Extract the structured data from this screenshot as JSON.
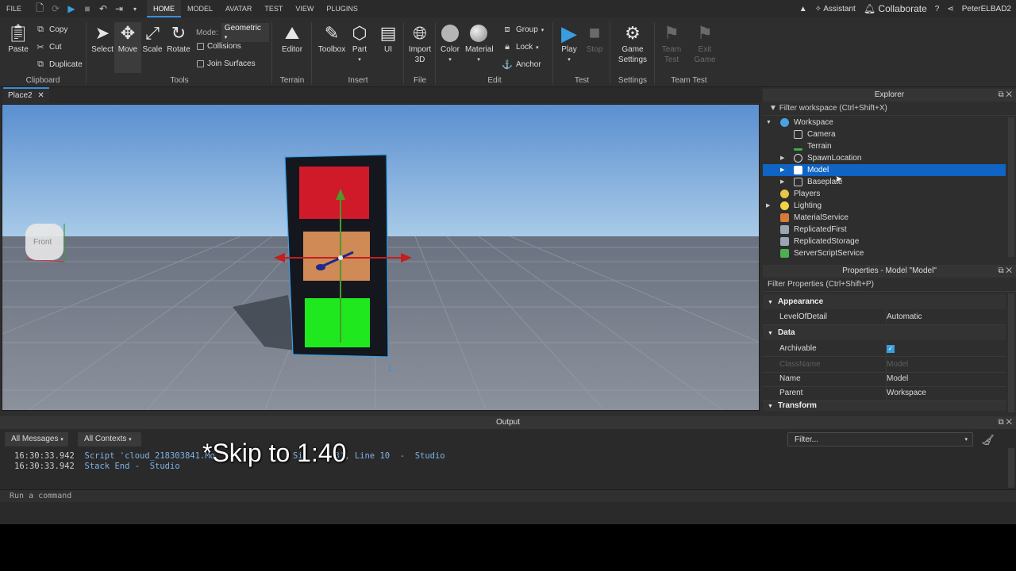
{
  "menu": {
    "file": "FILE",
    "tabs": [
      "HOME",
      "MODEL",
      "AVATAR",
      "TEST",
      "VIEW",
      "PLUGINS"
    ],
    "assistant": "Assistant",
    "collaborate": "Collaborate",
    "user": "PeterELBAD2"
  },
  "ribbon": {
    "clipboard": {
      "paste": "Paste",
      "copy": "Copy",
      "cut": "Cut",
      "duplicate": "Duplicate",
      "label": "Clipboard"
    },
    "tools": {
      "select": "Select",
      "move": "Move",
      "scale": "Scale",
      "rotate": "Rotate",
      "mode_label": "Mode:",
      "mode_value": "Geometric",
      "collisions": "Collisions",
      "join_surfaces": "Join Surfaces",
      "label": "Tools"
    },
    "terrain": {
      "editor": "Editor",
      "label": "Terrain"
    },
    "insert": {
      "toolbox": "Toolbox",
      "part": "Part",
      "ui": "UI",
      "label": "Insert"
    },
    "file": {
      "import_3d_line1": "Import",
      "import_3d_line2": "3D",
      "label": "File"
    },
    "edit": {
      "color": "Color",
      "material": "Material",
      "group": "Group",
      "lock": "Lock",
      "anchor": "Anchor",
      "label": "Edit"
    },
    "test": {
      "play": "Play",
      "stop": "Stop",
      "label": "Test"
    },
    "settings": {
      "game_line1": "Game",
      "game_line2": "Settings",
      "label": "Settings"
    },
    "team_test": {
      "team_line1": "Team",
      "team_line2": "Test",
      "exit_line1": "Exit",
      "exit_line2": "Game",
      "label": "Team Test"
    }
  },
  "doc_tab": "Place2",
  "viewport": {
    "view_cube": "Front"
  },
  "explorer": {
    "title": "Explorer",
    "filter": "Filter workspace (Ctrl+Shift+X)",
    "items": [
      {
        "label": "Workspace",
        "icon": "globe-icon",
        "color": "#4aa3df"
      },
      {
        "label": "Camera",
        "icon": "camera-icon",
        "color": "#cccccc"
      },
      {
        "label": "Terrain",
        "icon": "terrain-icon",
        "color": "#3cb043"
      },
      {
        "label": "SpawnLocation",
        "icon": "spawn-icon",
        "color": "#dddddd"
      },
      {
        "label": "Model",
        "icon": "model-icon",
        "color": "#ffffff"
      },
      {
        "label": "Baseplate",
        "icon": "part-icon",
        "color": "#cccccc"
      },
      {
        "label": "Players",
        "icon": "players-icon",
        "color": "#e8c547"
      },
      {
        "label": "Lighting",
        "icon": "lightbulb-icon",
        "color": "#f2d544"
      },
      {
        "label": "MaterialService",
        "icon": "material-icon",
        "color": "#d97a3a"
      },
      {
        "label": "ReplicatedFirst",
        "icon": "replicated-icon",
        "color": "#9aa6b2"
      },
      {
        "label": "ReplicatedStorage",
        "icon": "replicated-icon",
        "color": "#9aa6b2"
      },
      {
        "label": "ServerScriptService",
        "icon": "script-service-icon",
        "color": "#4caf50"
      }
    ]
  },
  "properties": {
    "title": "Properties - Model \"Model\"",
    "filter": "Filter Properties (Ctrl+Shift+P)",
    "sections": {
      "appearance": "Appearance",
      "data": "Data",
      "transform": "Transform"
    },
    "rows": {
      "level_of_detail": {
        "name": "LevelOfDetail",
        "value": "Automatic"
      },
      "archivable": {
        "name": "Archivable",
        "checked": true
      },
      "class_name": {
        "name": "ClassName",
        "value": "Model"
      },
      "name": {
        "name": "Name",
        "value": "Model"
      },
      "parent": {
        "name": "Parent",
        "value": "Workspace"
      }
    }
  },
  "output": {
    "title": "Output",
    "all_messages": "All Messages",
    "all_contexts": "All Contexts",
    "filter_placeholder": "Filter...",
    "line1_time": "16:30:33.942",
    "line1_text": "Script 'cloud_218303841.Mo",
    "line1_tail": "Si",
    "line1_end": "3', Line 10  -  Studio",
    "line2_time": "16:30:33.942",
    "line2_text": "Stack End",
    "line2_end": " -  Studio",
    "command_placeholder": "Run a command"
  },
  "caption": "*Skip to 1:40"
}
